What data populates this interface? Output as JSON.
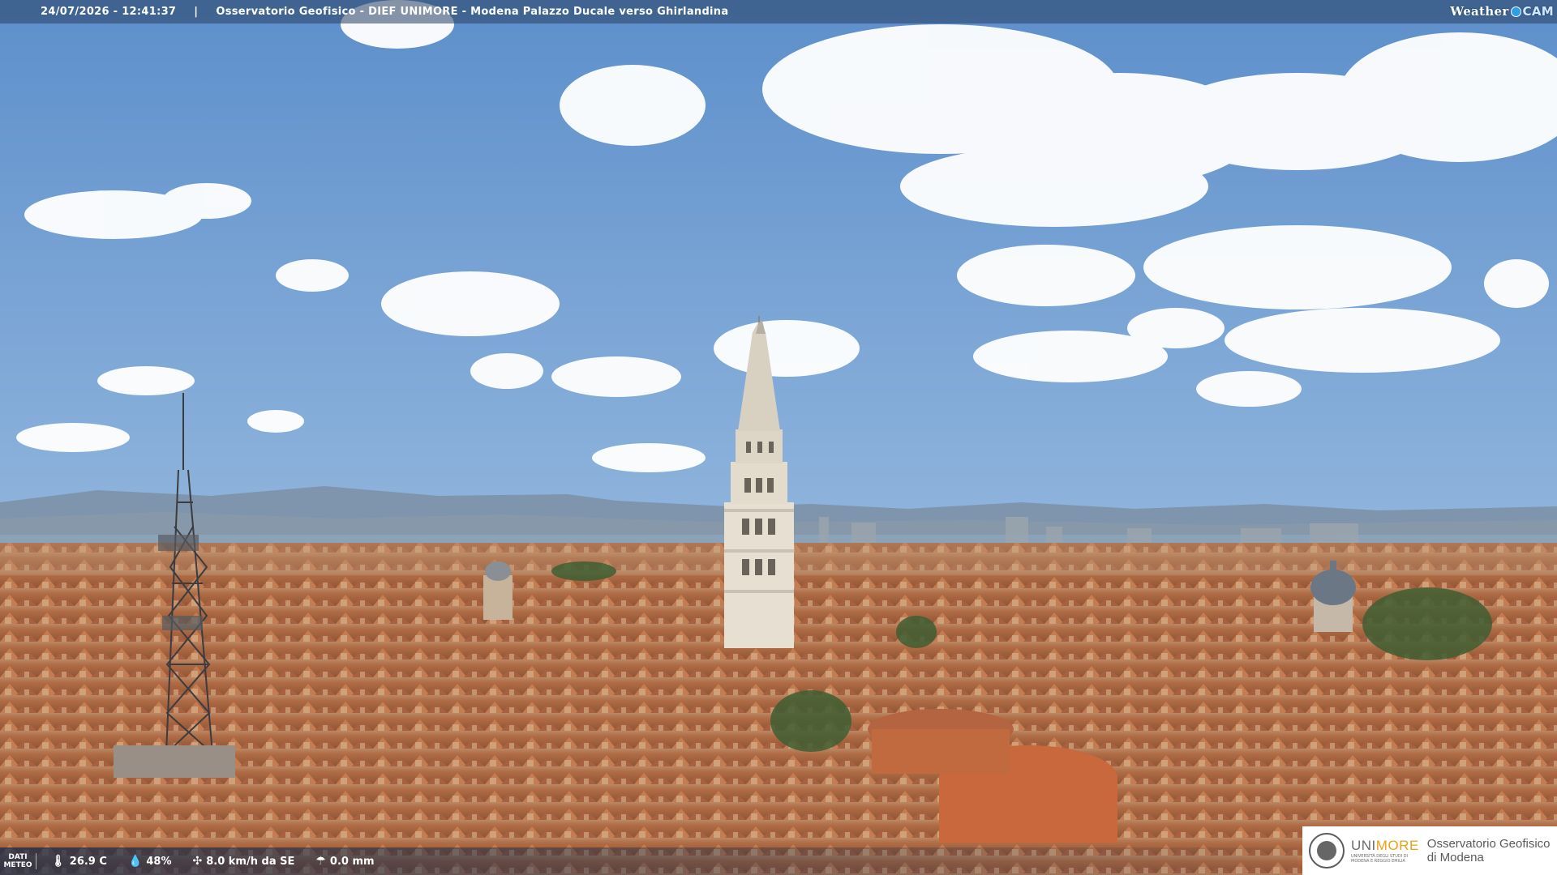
{
  "header": {
    "timestamp": "24/07/2026 - 12:41:37",
    "separator": "|",
    "title": "Osservatorio Geofisico - DIEF UNIMORE - Modena Palazzo Ducale verso Ghirlandina",
    "brand_weather": "Weather",
    "brand_cam": "CAM"
  },
  "footer": {
    "meteo_label_line1": "DATI",
    "meteo_label_line2": "METEO",
    "temperature": "26.9 C",
    "humidity": "48%",
    "wind": "8.0 km/h da SE",
    "rain": "0.0 mm"
  },
  "logo": {
    "uni_part1": "UNI",
    "uni_part2": "MORE",
    "uni_subline1": "UNIVERSITÀ DEGLI STUDI DI",
    "uni_subline2": "MODENA E REGGIO EMILIA",
    "observatory_line1": "Osservatorio Geofisico",
    "observatory_line2": "di Modena"
  },
  "colors": {
    "sky_top": "#5d8fcb",
    "sky_bottom": "#b9d2e6",
    "roofs": "#b5714a",
    "tower": "#e6dfd2",
    "unimore_accent": "#e4a414"
  }
}
